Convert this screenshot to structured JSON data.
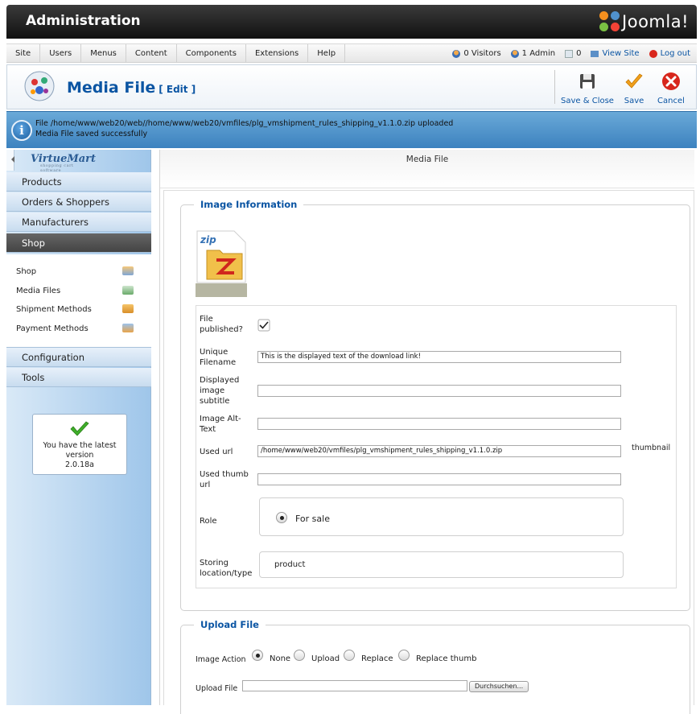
{
  "header": {
    "title": "Administration",
    "brand": "Joomla!"
  },
  "menu": {
    "items": [
      "Site",
      "Users",
      "Menus",
      "Content",
      "Components",
      "Extensions",
      "Help"
    ],
    "status": {
      "visitors": "0 Visitors",
      "admins": "1 Admin",
      "messages": "0",
      "view_site": "View Site",
      "logout": "Log out"
    }
  },
  "toolbar": {
    "page_title": "Media File",
    "edit_label": "[ Edit ]",
    "save_close": "Save & Close",
    "save": "Save",
    "cancel": "Cancel"
  },
  "message": {
    "line1": "File /home/www/web20/web//home/www/web20/vmfiles/plg_vmshipment_rules_shipping_v1.1.0.zip uploaded",
    "line2": "Media File saved successfully"
  },
  "sidebar": {
    "logo": "VirtueMart",
    "logo_sub": "shopping cart software",
    "nav": [
      "Products",
      "Orders & Shoppers",
      "Manufacturers",
      "Shop"
    ],
    "active": "Shop",
    "sub_items": [
      "Shop",
      "Media Files",
      "Shipment Methods",
      "Payment Methods"
    ],
    "nav_bottom": [
      "Configuration",
      "Tools"
    ],
    "version_text": "You have the latest version",
    "version": "2.0.18a"
  },
  "main": {
    "title": "Media File",
    "image_info": {
      "legend": "Image Information",
      "file_icon_label": "zip",
      "published_label": "File published?",
      "published": true,
      "unique_label": "Unique Filename",
      "unique_value": "This is the displayed text of the download link!",
      "subtitle_label": "Displayed image subtitle",
      "subtitle_value": "",
      "alt_label": "Image Alt-Text",
      "alt_value": "",
      "url_label": "Used url",
      "url_value": "/home/www/web20/vmfiles/plg_vmshipment_rules_shipping_v1.1.0.zip",
      "thumbnail_label": "thumbnail",
      "thumb_url_label": "Used thumb url",
      "thumb_url_value": "",
      "role_label": "Role",
      "role_value": "For sale",
      "location_label": "Storing location/type",
      "location_value": "product"
    },
    "upload": {
      "legend": "Upload File",
      "action_label": "Image Action",
      "options": [
        "None",
        "Upload",
        "Replace",
        "Replace thumb"
      ],
      "selected": "None",
      "file_label": "Upload File",
      "browse": "Durchsuchen..."
    }
  },
  "colors": {
    "accent": "#0b55a3",
    "message_bg": "#3c82bf",
    "header_bg": "#1a1a1a"
  }
}
